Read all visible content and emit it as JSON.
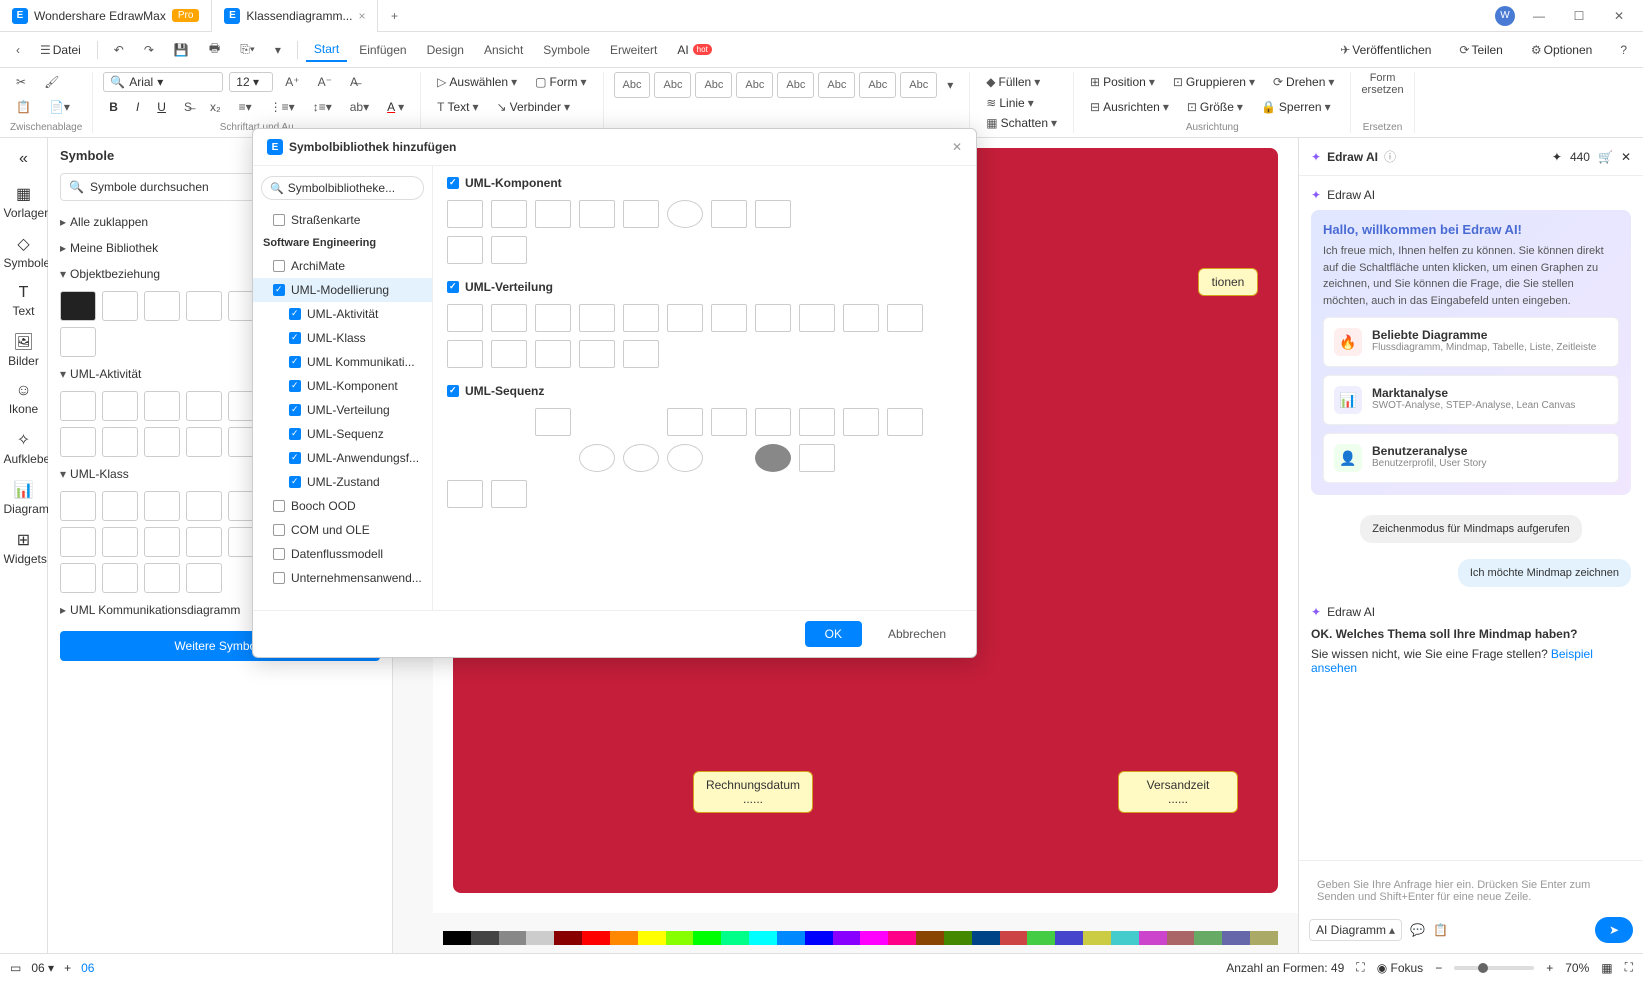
{
  "titlebar": {
    "app_name": "Wondershare EdrawMax",
    "pro": "Pro",
    "tab2": "Klassendiagramm...",
    "avatar": "W"
  },
  "menubar": {
    "file": "Datei",
    "items": [
      "Start",
      "Einfügen",
      "Design",
      "Ansicht",
      "Symbole",
      "Erweitert",
      "AI"
    ],
    "publish": "Veröffentlichen",
    "share": "Teilen",
    "options": "Optionen"
  },
  "ribbon": {
    "clipboard": "Zwischenablage",
    "font_name": "Arial",
    "font_size": "12",
    "font_group": "Schriftart und Au",
    "select": "Auswählen",
    "form": "Form",
    "text": "Text",
    "connector": "Verbinder",
    "abc": "Abc",
    "fill": "Füllen",
    "line": "Linie",
    "shadow": "Schatten",
    "position": "Position",
    "align": "Ausrichten",
    "group": "Gruppieren",
    "size": "Größe",
    "rotate": "Drehen",
    "lock": "Sperren",
    "align_group": "Ausrichtung",
    "form_replace": "Form\nersetzen",
    "replace_group": "Ersetzen"
  },
  "leftrail": {
    "templates": "Vorlagen",
    "symbols": "Symbole",
    "text": "Text",
    "images": "Bilder",
    "icons": "Ikone",
    "stickers": "Aufkleber",
    "diagrams": "Diagram...",
    "widgets": "Widgets"
  },
  "symbols": {
    "title": "Symbole",
    "search": "Symbole durchsuchen",
    "collapse": "Alle zuklappen",
    "sec1": "Meine Bibliothek",
    "sec2": "Objektbeziehung",
    "sec3": "UML-Aktivität",
    "sec4": "UML-Klass",
    "sec5": "UML Kommunikationsdiagramm",
    "more": "Weitere Symbole"
  },
  "modal": {
    "title": "Symbolbibliothek hinzufügen",
    "search": "Symbolbibliotheke...",
    "cat_sw": "Software Engineering",
    "items": {
      "strassenkarte": "Straßenkarte",
      "archimate": "ArchiMate",
      "uml_model": "UML-Modellierung",
      "uml_akt": "UML-Aktivität",
      "uml_klass": "UML-Klass",
      "uml_komm": "UML Kommunikati...",
      "uml_komp": "UML-Komponent",
      "uml_vert": "UML-Verteilung",
      "uml_seq": "UML-Sequenz",
      "uml_anw": "UML-Anwendungsf...",
      "uml_zust": "UML-Zustand",
      "booch": "Booch OOD",
      "com": "COM und OLE",
      "datenfluss": "Datenflussmodell",
      "unternehmen": "Unternehmensanwend..."
    },
    "sec_komp": "UML-Komponent",
    "sec_vert": "UML-Verteilung",
    "sec_seq": "UML-Sequenz",
    "ok": "OK",
    "cancel": "Abbrechen"
  },
  "canvas": {
    "box1": "Rechnungsdatum",
    "box2": "Versandzeit",
    "dots": "......",
    "box3_line": "tionen"
  },
  "ai": {
    "title": "Edraw AI",
    "points": "440",
    "from": "Edraw AI",
    "welcome_title": "Hallo, willkommen bei Edraw AI!",
    "welcome_desc": "Ich freue mich, Ihnen helfen zu können. Sie können direkt auf die Schaltfläche unten klicken, um einen Graphen zu zeichnen, und Sie können die Frage, die Sie stellen möchten, auch in das Eingabefeld unten eingeben.",
    "card1_t": "Beliebte Diagramme",
    "card1_d": "Flussdiagramm, Mindmap, Tabelle, Liste, Zeitleiste",
    "card2_t": "Marktanalyse",
    "card2_d": "SWOT-Analyse, STEP-Analyse, Lean Canvas",
    "card3_t": "Benutzeranalyse",
    "card3_d": "Benutzerprofil, User Story",
    "msg1": "Zeichenmodus für Mindmaps aufgerufen",
    "msg2": "Ich möchte Mindmap zeichnen",
    "q_title": "OK. Welches Thema soll Ihre Mindmap haben?",
    "q_help": "Sie wissen nicht, wie Sie eine Frage stellen?",
    "q_link": "Beispiel ansehen",
    "input_ph": "Geben Sie Ihre Anfrage hier ein. Drücken Sie Enter zum Senden und Shift+Enter für eine neue Zeile.",
    "ai_diagram": "AI Diagramm"
  },
  "statusbar": {
    "page1": "06",
    "page2": "06",
    "shapes": "Anzahl an Formen: 49",
    "focus": "Fokus",
    "zoom": "70%"
  }
}
